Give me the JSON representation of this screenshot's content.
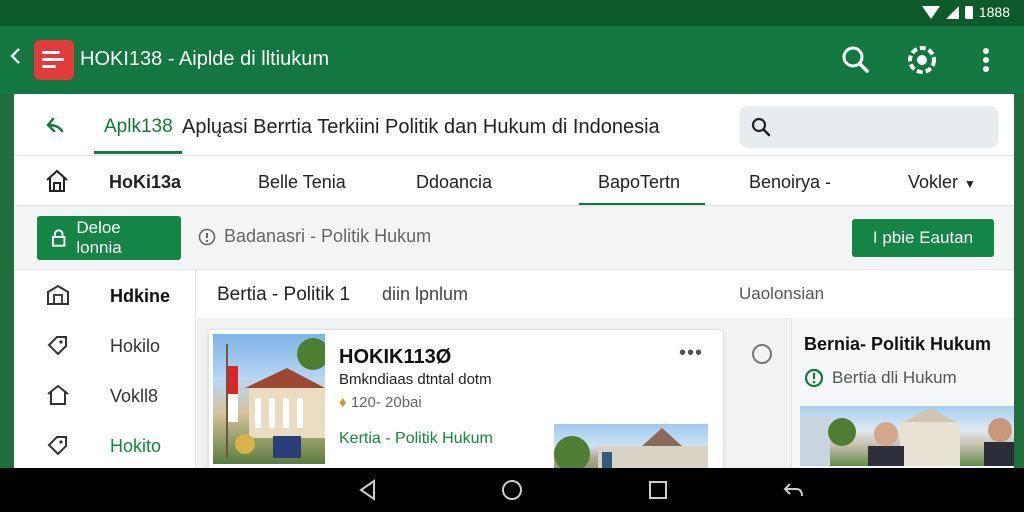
{
  "status_bar": {
    "time": "1888"
  },
  "app_bar": {
    "title": "HOKI138 - Aiplde di lltiukum",
    "icons": [
      "back-icon",
      "app-logo",
      "search-icon",
      "gear-icon",
      "more-vertical-icon"
    ]
  },
  "address_bar": {
    "site_link": "Aplk138",
    "headline": "Aplųasi Berrtia Terkiini Politik dan Hukum di Indonesia",
    "search_placeholder": ""
  },
  "nav": {
    "brand": "HoKi13a",
    "items": [
      "Belle Tenia",
      "Ddoancia",
      "BapoTertn",
      "Benoirya -",
      "Vokler"
    ]
  },
  "toolbar": {
    "left_button": "Deloe lonnia",
    "info_text": "Badanasri - Politik Hukum",
    "right_button": "I pbie Eautan"
  },
  "sidebar": {
    "items": [
      {
        "label": "Hdkine",
        "icon": "building-icon"
      },
      {
        "label": "Hokilo",
        "icon": "tag-icon"
      },
      {
        "label": "Vokll8",
        "icon": "home-icon"
      },
      {
        "label": "Hokito",
        "icon": "tag-icon"
      }
    ]
  },
  "main": {
    "heading_left": "Bertia - Politik 1",
    "heading_mid": "diin lpnlum",
    "heading_right": "Uaolonsian"
  },
  "card": {
    "title": "HOKIK113Ø",
    "subtitle": "Bmkndiaas dtntal dotm",
    "date": "120- 20bai",
    "tag": "Kertia - Politik Hukum"
  },
  "card2": {
    "title": "Bernia- Politik Hukum",
    "tag": "Bertia dli Hukum"
  },
  "colors": {
    "primary": "#13783f",
    "status_bar": "#0f5a2b",
    "accent_red": "#e23b3b",
    "button": "#148544"
  }
}
